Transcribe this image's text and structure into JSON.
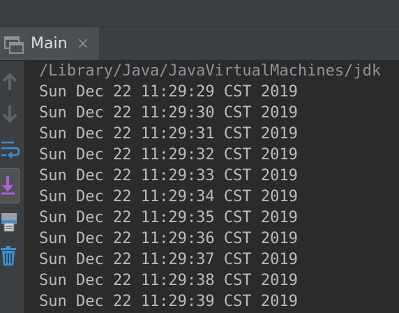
{
  "tab": {
    "label": "Main",
    "close_glyph": "×"
  },
  "toolbar": {
    "icons": [
      "up-arrow-icon",
      "down-arrow-icon",
      "soft-wrap-icon",
      "scroll-to-end-icon",
      "print-icon",
      "trash-icon"
    ]
  },
  "console": {
    "command": "/Library/Java/JavaVirtualMachines/jdk",
    "lines": [
      "Sun Dec 22 11:29:29 CST 2019",
      "Sun Dec 22 11:29:30 CST 2019",
      "Sun Dec 22 11:29:31 CST 2019",
      "Sun Dec 22 11:29:32 CST 2019",
      "Sun Dec 22 11:29:33 CST 2019",
      "Sun Dec 22 11:29:34 CST 2019",
      "Sun Dec 22 11:29:35 CST 2019",
      "Sun Dec 22 11:29:36 CST 2019",
      "Sun Dec 22 11:29:37 CST 2019",
      "Sun Dec 22 11:29:38 CST 2019",
      "Sun Dec 22 11:29:39 CST 2019"
    ]
  },
  "colors": {
    "background": "#2b2b2b",
    "panel": "#3c3f41",
    "active_tab": "#4b4f52",
    "text": "#bbbbbb",
    "path_text": "#8d949b",
    "accent_blue": "#3d8fd6",
    "accent_purple": "#b05fd6"
  }
}
